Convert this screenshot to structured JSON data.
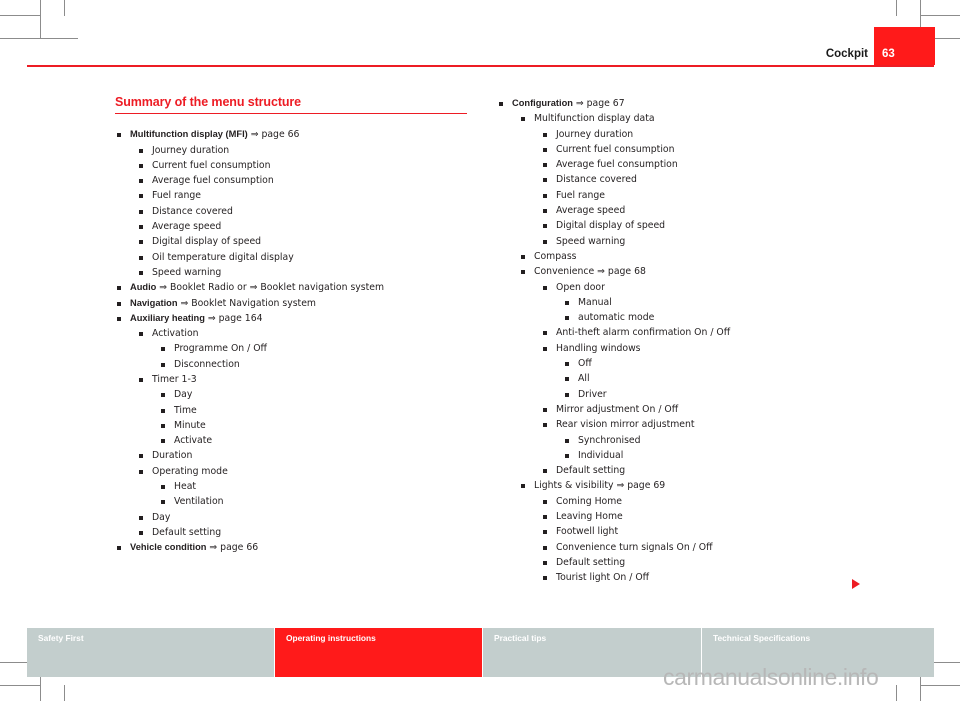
{
  "header": {
    "chapter": "Cockpit",
    "page_number": "63",
    "accent_color": "#ed1c24"
  },
  "content": {
    "section_title": "Summary of the menu structure",
    "left_column": [
      {
        "level": 1,
        "bold": "Multifunction display (MFI)",
        "ref": "⇒ page 66"
      },
      {
        "level": 2,
        "text": "Journey duration"
      },
      {
        "level": 2,
        "text": "Current fuel consumption"
      },
      {
        "level": 2,
        "text": "Average fuel consumption"
      },
      {
        "level": 2,
        "text": "Fuel range"
      },
      {
        "level": 2,
        "text": "Distance covered"
      },
      {
        "level": 2,
        "text": "Average speed"
      },
      {
        "level": 2,
        "text": "Digital display of speed"
      },
      {
        "level": 2,
        "text": "Oil temperature digital display"
      },
      {
        "level": 2,
        "text": "Speed warning"
      },
      {
        "level": 1,
        "bold": "Audio",
        "ref": "⇒ Booklet Radio or ⇒ Booklet navigation system"
      },
      {
        "level": 1,
        "bold": "Navigation",
        "ref": "⇒ Booklet Navigation system"
      },
      {
        "level": 1,
        "bold": "Auxiliary heating",
        "ref": "⇒ page 164"
      },
      {
        "level": 2,
        "text": "Activation"
      },
      {
        "level": 3,
        "text": "Programme On / Off"
      },
      {
        "level": 3,
        "text": "Disconnection"
      },
      {
        "level": 2,
        "text": "Timer 1-3"
      },
      {
        "level": 3,
        "text": "Day"
      },
      {
        "level": 3,
        "text": "Time"
      },
      {
        "level": 3,
        "text": "Minute"
      },
      {
        "level": 3,
        "text": "Activate"
      },
      {
        "level": 2,
        "text": "Duration"
      },
      {
        "level": 2,
        "text": "Operating mode"
      },
      {
        "level": 3,
        "text": "Heat"
      },
      {
        "level": 3,
        "text": "Ventilation"
      },
      {
        "level": 2,
        "text": "Day"
      },
      {
        "level": 2,
        "text": "Default setting"
      },
      {
        "level": 1,
        "bold": "Vehicle condition",
        "ref": "⇒ page 66"
      }
    ],
    "right_column": [
      {
        "level": 1,
        "bold": "Configuration",
        "ref": "⇒ page 67"
      },
      {
        "level": 2,
        "text": "Multifunction display data"
      },
      {
        "level": 3,
        "text": "Journey duration"
      },
      {
        "level": 3,
        "text": "Current fuel consumption"
      },
      {
        "level": 3,
        "text": "Average fuel consumption"
      },
      {
        "level": 3,
        "text": "Distance covered"
      },
      {
        "level": 3,
        "text": "Fuel range"
      },
      {
        "level": 3,
        "text": "Average speed"
      },
      {
        "level": 3,
        "text": "Digital display of speed"
      },
      {
        "level": 3,
        "text": "Speed warning"
      },
      {
        "level": 2,
        "text": "Compass"
      },
      {
        "level": 2,
        "text": "Convenience ⇒ page 68"
      },
      {
        "level": 3,
        "text": "Open door"
      },
      {
        "level": 4,
        "text": "Manual"
      },
      {
        "level": 4,
        "text": "automatic mode"
      },
      {
        "level": 3,
        "text": "Anti-theft alarm confirmation On / Off"
      },
      {
        "level": 3,
        "text": "Handling windows"
      },
      {
        "level": 4,
        "text": "Off"
      },
      {
        "level": 4,
        "text": "All"
      },
      {
        "level": 4,
        "text": "Driver"
      },
      {
        "level": 3,
        "text": "Mirror adjustment On / Off"
      },
      {
        "level": 3,
        "text": "Rear vision mirror adjustment"
      },
      {
        "level": 4,
        "text": "Synchronised"
      },
      {
        "level": 4,
        "text": "Individual"
      },
      {
        "level": 3,
        "text": "Default setting"
      },
      {
        "level": 2,
        "text": "Lights & visibility ⇒ page 69"
      },
      {
        "level": 3,
        "text": "Coming Home"
      },
      {
        "level": 3,
        "text": "Leaving Home"
      },
      {
        "level": 3,
        "text": "Footwell light"
      },
      {
        "level": 3,
        "text": "Convenience turn signals On / Off"
      },
      {
        "level": 3,
        "text": "Default setting"
      },
      {
        "level": 3,
        "text": "Tourist light On / Off"
      }
    ],
    "continue_arrow": "▶"
  },
  "footer": {
    "tabs": [
      {
        "label": "Safety First",
        "active": false
      },
      {
        "label": "Operating instructions",
        "active": true
      },
      {
        "label": "Practical tips",
        "active": false
      },
      {
        "label": "Technical Specifications",
        "active": false
      }
    ],
    "active_color": "#ff1a1a",
    "inactive_color": "#c3cecd"
  },
  "watermark": "carmanualsonline.info"
}
